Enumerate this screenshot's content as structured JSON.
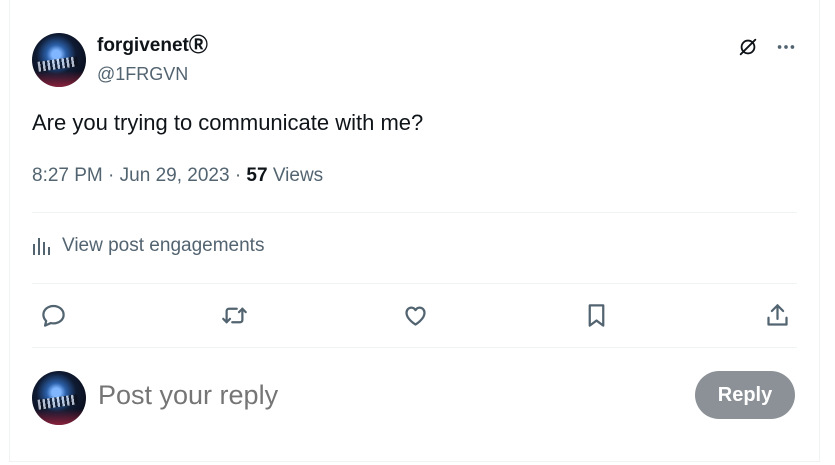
{
  "author": {
    "display_name": "forgivenetⓇ",
    "handle": "@1FRGVN"
  },
  "tweet": {
    "text": "Are you trying to communicate with me?",
    "time": "8:27 PM",
    "date": "Jun 29, 2023",
    "views_count": "57",
    "views_label": "Views"
  },
  "engagements": {
    "label": "View post engagements"
  },
  "actions": {
    "reply_icon": "reply-icon",
    "repost_icon": "repost-icon",
    "like_icon": "like-icon",
    "bookmark_icon": "bookmark-icon",
    "share_icon": "share-icon"
  },
  "composer": {
    "placeholder": "Post your reply",
    "reply_button": "Reply"
  },
  "colors": {
    "text_primary": "#0f1419",
    "text_secondary": "#536471",
    "divider": "#eff3f4",
    "reply_button_disabled": "#8b9196"
  }
}
